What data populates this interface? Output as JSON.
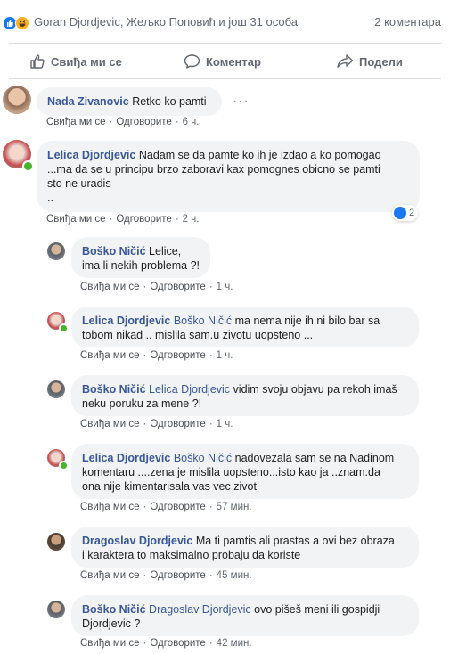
{
  "reactions": {
    "names": "Goran Djordjevic, Жељко Поповић и још 31 особа",
    "comment_count": "2 коментара",
    "icons": [
      "like-icon",
      "haha-icon"
    ]
  },
  "actions": {
    "like": "Свиђа ми се",
    "comment": "Коментар",
    "share": "Подели"
  },
  "meta_labels": {
    "like": "Свиђа ми се",
    "reply": "Одговорите",
    "sep": "·"
  },
  "comments": [
    {
      "author": "Nada Zivanovic",
      "mention": "",
      "text": "Retko ko pamti",
      "time": "6 ч."
    },
    {
      "author": "Lelica Djordjevic",
      "mention": "",
      "text_lines": [
        "Nadam se da pamte ko ih je izdao a ko pomogao",
        "...ma da se u principu brzo zaboravi kax pomognes obicno se pamti",
        "sto ne uradis",
        ".."
      ],
      "time": "2 ч.",
      "like_count": "2"
    },
    {
      "author": "Boško Ničić",
      "mention": "",
      "text_lines": [
        "Lelice,",
        "ima li nekih problema ?!"
      ],
      "time": "1 ч."
    },
    {
      "author": "Lelica Djordjevic",
      "mention": "Boško Ničić",
      "text_lines": [
        "ma nema nije ih ni bilo bar sa",
        "tobom nikad .. mislila sam.u zivotu uopsteno ..."
      ],
      "time": "1 ч."
    },
    {
      "author": "Boško Ničić",
      "mention": "Lelica Djordjevic",
      "text_lines": [
        "vidim svoju objavu pa rekoh imaš",
        "neku poruku za mene ?!"
      ],
      "time": "1 ч."
    },
    {
      "author": "Lelica Djordjevic",
      "mention": "Boško Ničić",
      "text_lines": [
        "nadovezala sam se na Nadinom",
        "komentaru ....zena je mislila uopsteno...isto kao ja ..znam.da",
        "ona nije kimentarisala vas vec zivot"
      ],
      "time": "57 мин."
    },
    {
      "author": "Dragoslav Djordjevic",
      "mention": "",
      "text_lines": [
        "Ma ti pamtis ali prastas a ovi bez obraza",
        "i karaktera to maksimalno probaju da koriste"
      ],
      "time": "45 мин."
    },
    {
      "author": "Boško Ničić",
      "mention": "Dragoslav Djordjevic",
      "text_lines": [
        "ovo pišeš meni ili gospidji",
        "Djordjevic ?"
      ],
      "time": "42 мин."
    }
  ]
}
